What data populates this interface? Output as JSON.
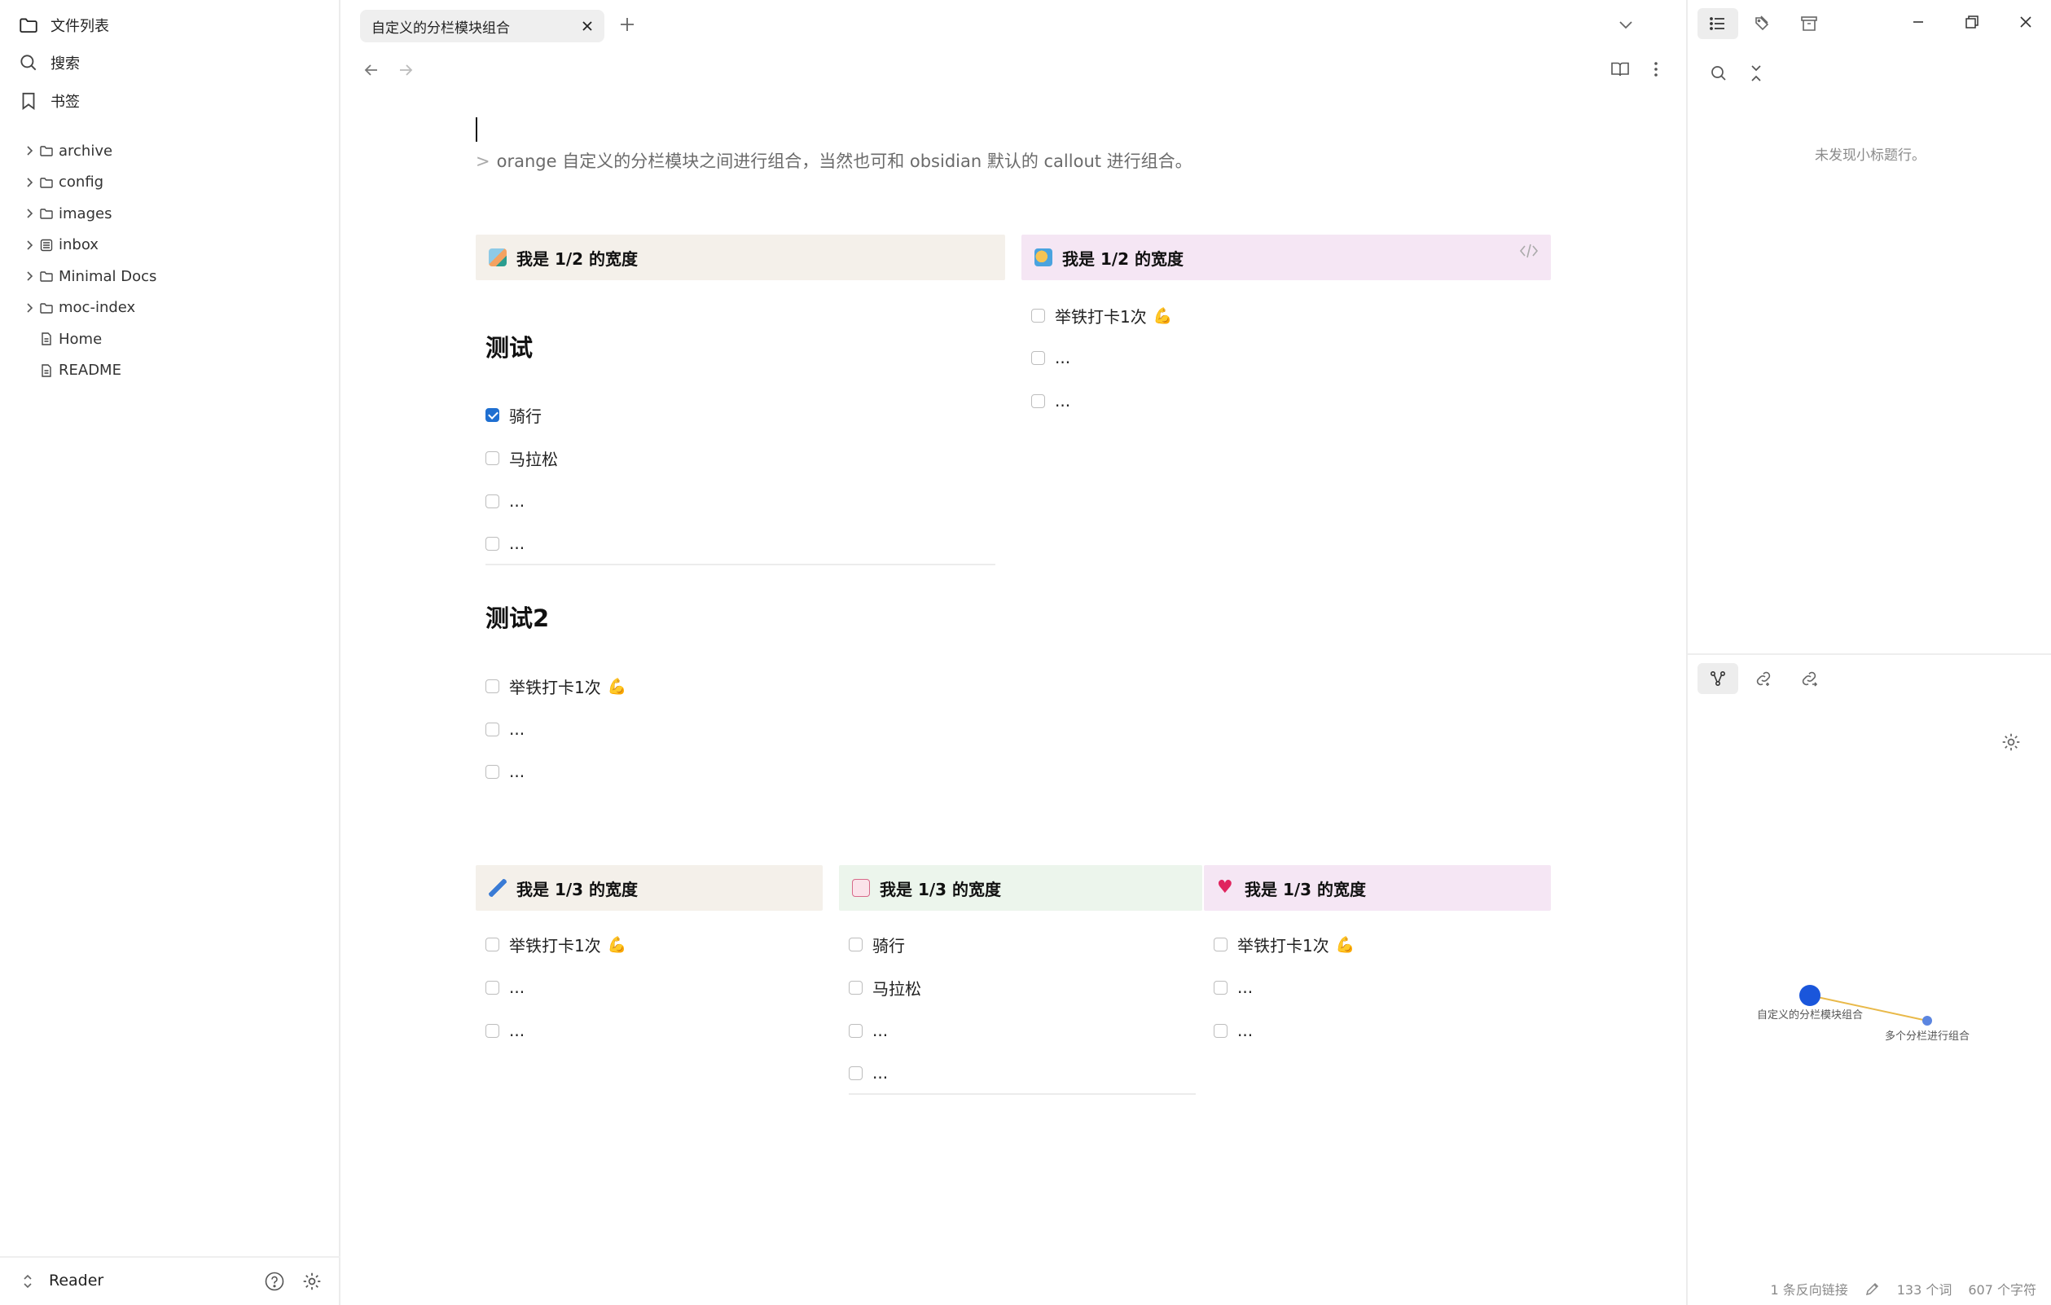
{
  "sidebar": {
    "nav": [
      {
        "label": "文件列表",
        "icon": "folder-icon"
      },
      {
        "label": "搜索",
        "icon": "search-icon"
      },
      {
        "label": "书签",
        "icon": "bookmark-icon"
      }
    ],
    "tree": [
      {
        "label": "archive",
        "type": "folder"
      },
      {
        "label": "config",
        "type": "folder"
      },
      {
        "label": "images",
        "type": "folder"
      },
      {
        "label": "inbox",
        "type": "folder-special"
      },
      {
        "label": "Minimal Docs",
        "type": "folder"
      },
      {
        "label": "moc-index",
        "type": "folder"
      },
      {
        "label": "Home",
        "type": "file"
      },
      {
        "label": "README",
        "type": "file"
      }
    ],
    "vault_name": "Reader"
  },
  "tab": {
    "title": "自定义的分栏模块组合"
  },
  "document": {
    "quote": "orange 自定义的分栏模块之间进行组合，当然也可和 obsidian 默认的 callout 进行组合。",
    "quote_marker": ">",
    "col_half_left": {
      "title": "我是 1/2 的宽度",
      "color": "#f4f0ea",
      "heading1": "测试",
      "tasks1": [
        {
          "text": "骑行",
          "checked": true
        },
        {
          "text": "马拉松",
          "checked": false
        },
        {
          "text": "...",
          "checked": false
        },
        {
          "text": "...",
          "checked": false
        }
      ],
      "heading2": "测试2",
      "tasks2": [
        {
          "text": "举铁打卡1次",
          "checked": false,
          "emoji": "💪"
        },
        {
          "text": "...",
          "checked": false
        },
        {
          "text": "...",
          "checked": false
        }
      ]
    },
    "col_half_right": {
      "title": "我是 1/2 的宽度",
      "color": "#f5e6f4",
      "tasks": [
        {
          "text": "举铁打卡1次",
          "checked": false,
          "emoji": "💪"
        },
        {
          "text": "...",
          "checked": false
        },
        {
          "text": "...",
          "checked": false
        }
      ]
    },
    "col_third_1": {
      "title": "我是 1/3 的宽度",
      "color": "#f4f0ea",
      "tasks": [
        {
          "text": "举铁打卡1次",
          "checked": false,
          "emoji": "💪"
        },
        {
          "text": "...",
          "checked": false
        },
        {
          "text": "...",
          "checked": false
        }
      ]
    },
    "col_third_2": {
      "title": "我是 1/3 的宽度",
      "color": "#ecf5ec",
      "tasks": [
        {
          "text": "骑行",
          "checked": false
        },
        {
          "text": "马拉松",
          "checked": false
        },
        {
          "text": "...",
          "checked": false
        },
        {
          "text": "...",
          "checked": false
        }
      ]
    },
    "col_third_3": {
      "title": "我是 1/3 的宽度",
      "color": "#f5e6f4",
      "tasks": [
        {
          "text": "举铁打卡1次",
          "checked": false,
          "emoji": "💪"
        },
        {
          "text": "...",
          "checked": false
        },
        {
          "text": "...",
          "checked": false
        }
      ]
    }
  },
  "right_panel": {
    "outline_empty": "未发现小标题行。",
    "graph": {
      "node_main": "自定义的分栏模块组合",
      "node_other": "多个分栏进行组合",
      "accent": "#1a56db",
      "edge_color": "#e9b949"
    },
    "status": {
      "backlinks": "1 条反向链接",
      "words": "133 个词",
      "chars": "607 个字符"
    }
  }
}
